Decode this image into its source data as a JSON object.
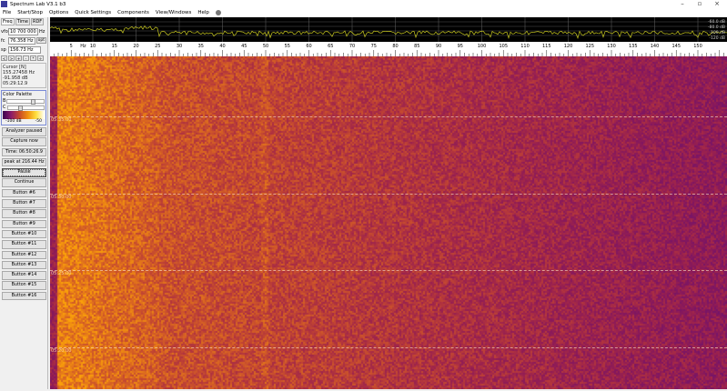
{
  "window": {
    "title": "Spectrum Lab V3.1 b3",
    "minimize": "–",
    "maximize": "▫",
    "close": "×"
  },
  "menu": [
    "File",
    "Start/Stop",
    "Options",
    "Quick Settings",
    "Components",
    "View/Windows",
    "Help"
  ],
  "left": {
    "tabs": [
      "Freq",
      "Time",
      "RDF"
    ],
    "vfo": {
      "label": "vfo",
      "value": "10 700 000",
      "unit": "Hz"
    },
    "fc": {
      "label": "fc",
      "value": "76.358 Hz",
      "button": "opt"
    },
    "sp": {
      "label": "sp",
      "value": "156.73 Hz"
    },
    "arrows": [
      "<",
      ">",
      "+",
      "-",
      "*",
      "÷"
    ],
    "cursor": {
      "title": "Cursor [N]",
      "freq": "155.27458 Hz",
      "level": "-91.958 dB",
      "time": "05:29:12.9"
    },
    "palette": {
      "title": "Color Palette",
      "b_label": "B",
      "c_label": "C",
      "b_level": 0.65,
      "c_level": 0.3,
      "min": "-100 dB",
      "max": "-50"
    },
    "buttons": [
      "Analyzer paused",
      "Capture now",
      "Time:  06:50:26.9",
      "peak at 216.44 Hz",
      "Pause",
      "Continue",
      "Button #6",
      "Button #7",
      "Button #8",
      "Button #9",
      "Button #10",
      "Button #11",
      "Button #12",
      "Button #13",
      "Button #14",
      "Button #15",
      "Button #16"
    ]
  },
  "spectrum": {
    "db_labels": [
      "-60.0 dB",
      "-80.0 dB",
      "-100 dB",
      "-120 dB"
    ],
    "trace_color": "#c8c820"
  },
  "freq_axis": {
    "unit": "Hz",
    "labels": [
      "5",
      "10",
      "15",
      "20",
      "25",
      "30",
      "35",
      "40",
      "45",
      "50",
      "55",
      "60",
      "65",
      "70",
      "75",
      "80",
      "85",
      "90",
      "95",
      "100",
      "105",
      "110",
      "115",
      "120",
      "125",
      "130",
      "135",
      "140",
      "145",
      "150"
    ]
  },
  "waterfall": {
    "time_labels": [
      "05:35:00",
      "05:30:00",
      "05:25:00",
      "05:20:00"
    ]
  }
}
